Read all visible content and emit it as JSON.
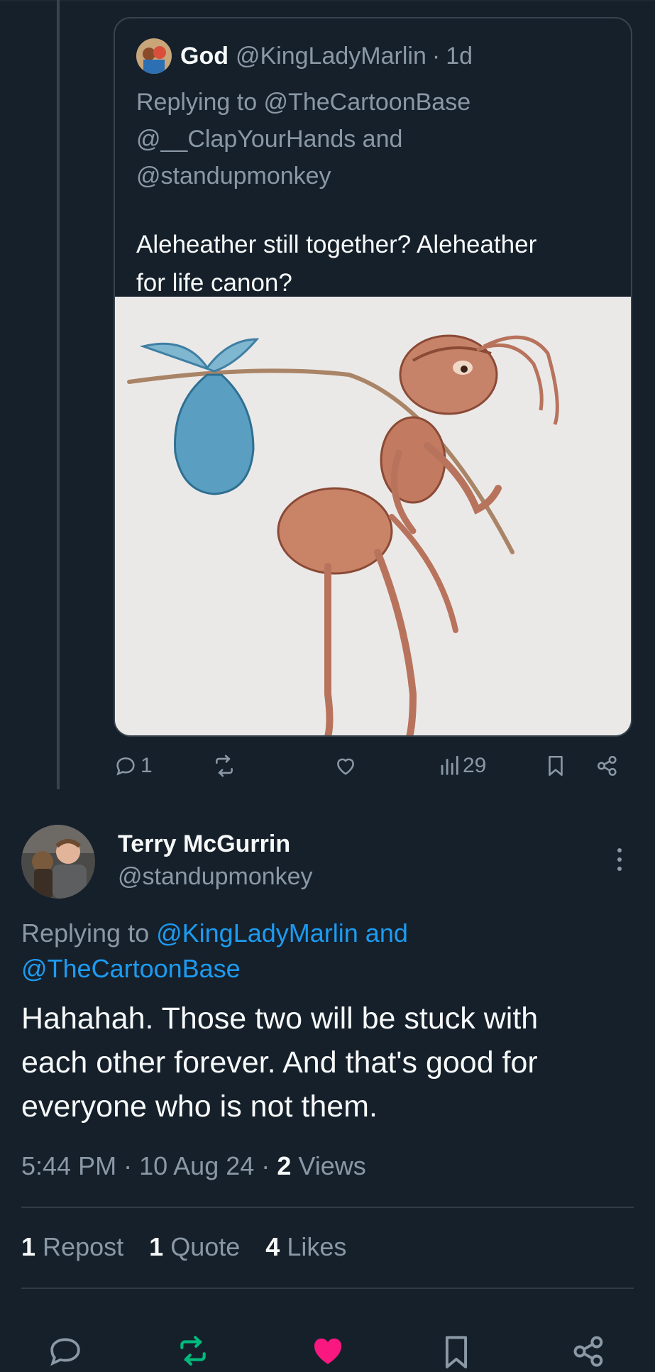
{
  "quoted_tweet": {
    "author_name": "God",
    "author_handle": "@KingLadyMarlin",
    "separator": "·",
    "time": "1d",
    "replying_to_line1": "Replying to @TheCartoonBase",
    "replying_to_line2": "@__ClapYourHands and",
    "replying_to_line3": "@standupmonkey",
    "text_line1": "Aleheather still together? Aleheather",
    "text_line2": "for life canon?",
    "actions": {
      "reply_count": "1",
      "views_count": "29"
    }
  },
  "tweet": {
    "author_name": "Terry McGurrin",
    "author_handle": "@standupmonkey",
    "replying_prefix": "Replying to ",
    "replying_link1": "@KingLadyMarlin",
    "replying_and": " and",
    "replying_link2": "@TheCartoonBase",
    "text_line1": "Hahahah. Those two will be stuck with",
    "text_line2": "each other forever. And that's good for",
    "text_line3": "everyone who is not them.",
    "time": "5:44 PM",
    "dot": "·",
    "date": "10 Aug 24",
    "views_count": "2",
    "views_label": "Views",
    "reposts_count": "1",
    "reposts_label": "Repost",
    "quotes_count": "1",
    "quotes_label": "Quote",
    "likes_count": "4",
    "likes_label": "Likes"
  },
  "colors": {
    "background": "#15202b",
    "link": "#1d9bf0",
    "muted": "#8b98a5",
    "repost_active": "#00ba7c",
    "like_active": "#f91880"
  }
}
